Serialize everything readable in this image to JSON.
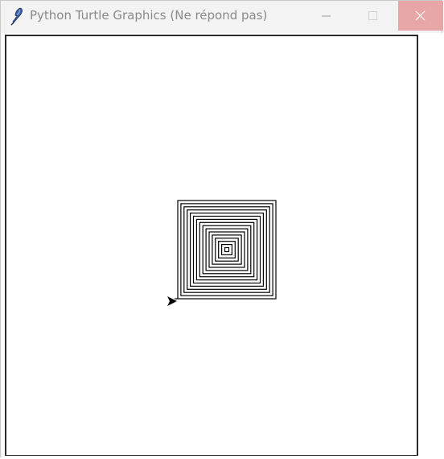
{
  "window": {
    "title": "Python Turtle Graphics (Ne répond pas)",
    "icon": "feather-icon"
  },
  "titlebar_buttons": {
    "minimize": "minimize-icon",
    "maximize": "maximize-icon",
    "close": "close-icon"
  },
  "colors": {
    "titlebar_bg": "#f3f3f3",
    "title_text": "#8a8a8a",
    "close_hover": "#e8a7a7",
    "canvas_bg": "#ffffff",
    "pen": "#000000"
  },
  "turtle": {
    "shape": "arrow",
    "heading": "east",
    "pen_color": "#000000"
  },
  "drawing": {
    "type": "square-spiral",
    "rings": 16
  }
}
